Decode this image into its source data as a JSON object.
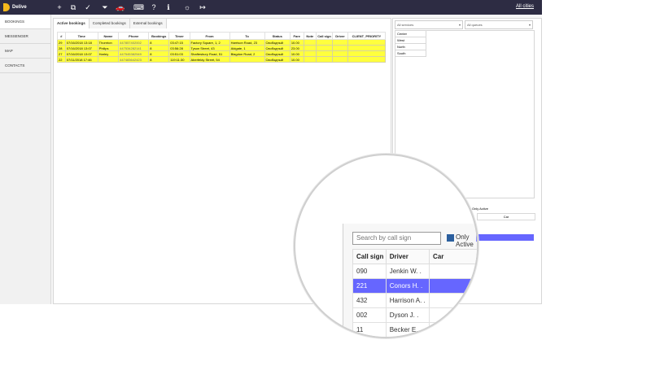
{
  "app": {
    "name": "Delive"
  },
  "topbar": {
    "all_cities": "All cities"
  },
  "sidebar": {
    "items": [
      {
        "label": "BOOKINGS"
      },
      {
        "label": "MESSENGER"
      },
      {
        "label": "MAP"
      },
      {
        "label": "CONTACTS"
      }
    ]
  },
  "tabs": [
    {
      "label": "Active bookings"
    },
    {
      "label": "Completed bookings"
    },
    {
      "label": "External bookings"
    }
  ],
  "table": {
    "headers": [
      "#",
      "Time",
      "Name",
      "Phone",
      "Bookings",
      "Timer",
      "From",
      "To",
      "Status",
      "Fare",
      "Note",
      "Call sign",
      "Driver",
      "CLIENT_PRIORITY"
    ],
    "rows": [
      [
        "29",
        "07/16/2018 13:18",
        "Thornton",
        "447857402002",
        "8",
        "03:47:15",
        "Factory Square, 1, 2",
        "Harrison Road, 23",
        "Свободный",
        "10.00",
        "",
        "",
        "",
        ""
      ],
      [
        "28",
        "07/16/2018 13:07",
        "Philips",
        "447534282141",
        "8",
        "03:56:28",
        "Tyson Street, 43",
        "Aldgate, 1",
        "Свободный",
        "23.00",
        "",
        "",
        "",
        ""
      ],
      [
        "27",
        "07/16/2018 13:07",
        "Harley",
        "447545382549",
        "8",
        "03:51:03",
        "Shaftesbury Road, 51",
        "Blagdon Road, 2",
        "Свободный",
        "10.00",
        "",
        "",
        "",
        ""
      ],
      [
        "22",
        "07/11/2018 17:46",
        "",
        "447483642423",
        "8",
        "119:11:30",
        "Aberfeldy Street, 54",
        "",
        "Свободный",
        "10.00",
        "",
        "",
        "",
        ""
      ]
    ]
  },
  "filters": {
    "services": "All services",
    "queues": "All queues"
  },
  "zones": [
    "Center",
    "West",
    "North",
    "South"
  ],
  "right_panel": {
    "only_active": "Only Active",
    "car_header": "Car"
  },
  "drivers": {
    "search_placeholder": "Search by call sign",
    "only_active": "Only Active",
    "headers": [
      "Call sign",
      "Driver",
      "Car"
    ],
    "rows": [
      {
        "call_sign": "090",
        "driver": "Jenkin W. .",
        "car": ""
      },
      {
        "call_sign": "221",
        "driver": "Conors H. .",
        "car": ""
      },
      {
        "call_sign": "432",
        "driver": "Harrison A. .",
        "car": ""
      },
      {
        "call_sign": "002",
        "driver": "Dyson J. .",
        "car": ""
      },
      {
        "call_sign": "11",
        "driver": "Becker E. .",
        "car": ""
      }
    ]
  }
}
